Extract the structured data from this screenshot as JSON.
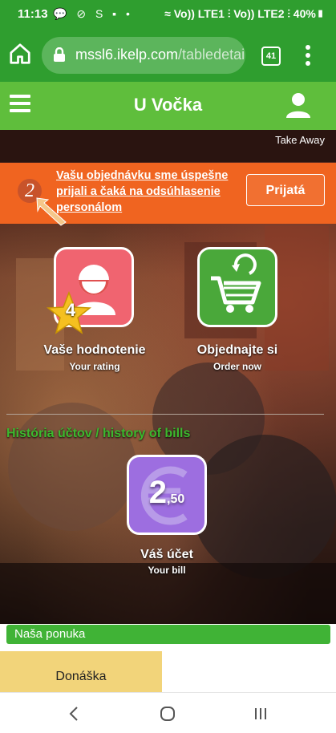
{
  "status_bar": {
    "time": "11:13",
    "notif_icons": "💬 ⊘ S ▪ •",
    "right_text": "≈ Vo)) LTE1 ⫶ Vo)) LTE2 ⫶ 40%▮"
  },
  "browser": {
    "url_host": "mssl6.ikelp.com",
    "url_path": "/tabledetai",
    "tab_count": "41"
  },
  "app": {
    "title": "U Vočka"
  },
  "takeaway": "Take Away",
  "banner": {
    "number": "2",
    "text": "Vašu objednávku sme úspešne prijali a čaká na odsúhlasenie personálom",
    "status_button": "Prijatá"
  },
  "tiles": {
    "rating": {
      "label": "Vaše hodnotenie",
      "sub": "Your rating",
      "badge": "4"
    },
    "order": {
      "label": "Objednajte si",
      "sub": "Order now"
    },
    "bill": {
      "label": "Váš účet",
      "sub": "Your bill",
      "amount_main": "2",
      "amount_decimal": ",50"
    }
  },
  "history_link": "História účtov / history of bills",
  "offer": {
    "title": "Naša ponuka",
    "category": "Donáška"
  },
  "colors": {
    "green": "#2f9e2f",
    "app_green": "#5fbe3c",
    "orange": "#f06420",
    "pink": "#f06470",
    "purple": "#9d6ee0"
  },
  "icons": [
    "home-icon",
    "lock-icon",
    "tabs-icon",
    "more-vert-icon",
    "hamburger-icon",
    "user-icon",
    "star-icon",
    "person-icon",
    "cart-icon",
    "euro-icon",
    "back-icon",
    "home-nav-icon",
    "recents-icon"
  ]
}
